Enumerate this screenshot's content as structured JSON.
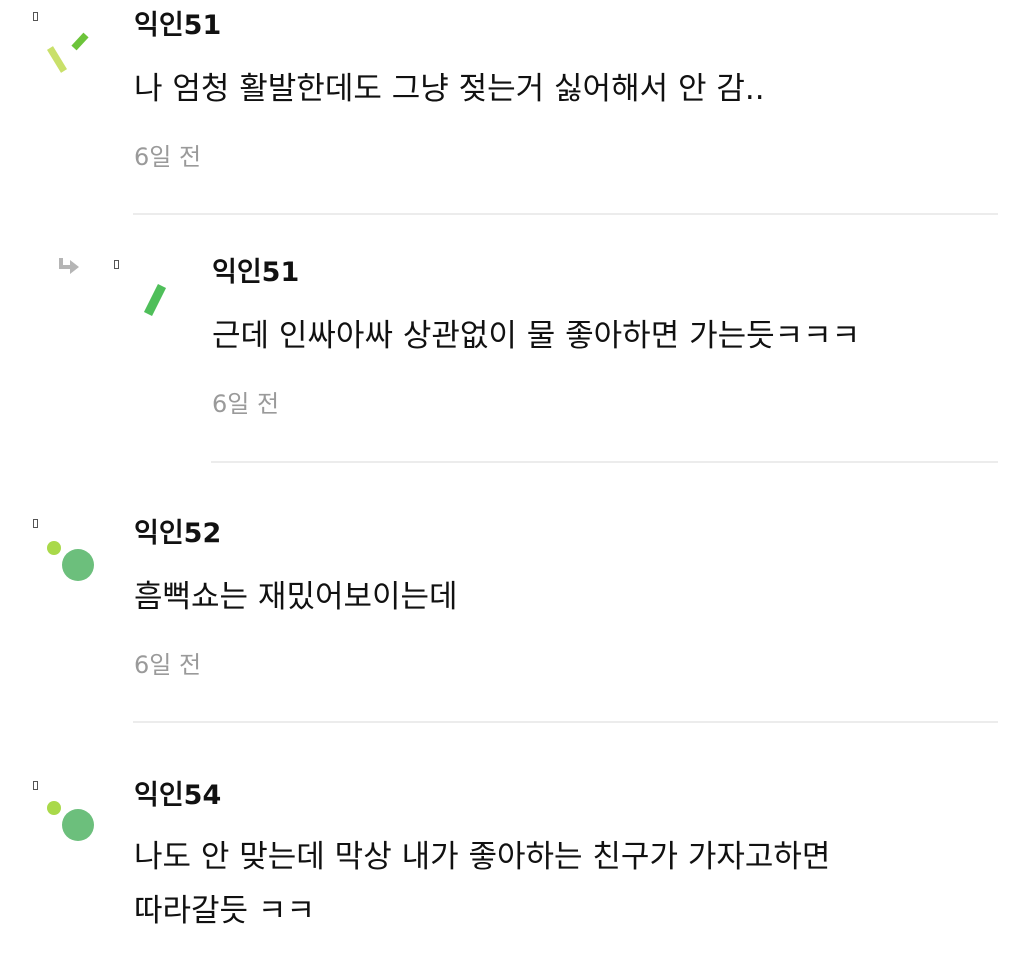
{
  "comments": [
    {
      "author": "익인51",
      "text": "나 엄청 활발한데도 그냥 젖는거 싫어해서 안 감..",
      "time": "6일 전"
    },
    {
      "author": "익인51",
      "text": "근데 인싸아싸 상관없이 물 좋아하면 가는듯ㅋㅋㅋ",
      "time": "6일 전",
      "is_reply": true
    },
    {
      "author": "익인52",
      "text": "흠뻑쇼는 재밌어보이는데",
      "time": "6일 전"
    },
    {
      "author": "익인54",
      "text_lines": [
        "나도 안 맞는데 막상 내가 좋아하는 친구가 가자고하면",
        "따라갈듯 ㅋㅋ"
      ]
    }
  ],
  "colors": {
    "avatar_green": "#6cbf7c",
    "avatar_lime": "#a9d94a",
    "avatar_yellow_green": "#c9e06a",
    "time_gray": "#9a9a9a",
    "divider": "#ececec"
  }
}
